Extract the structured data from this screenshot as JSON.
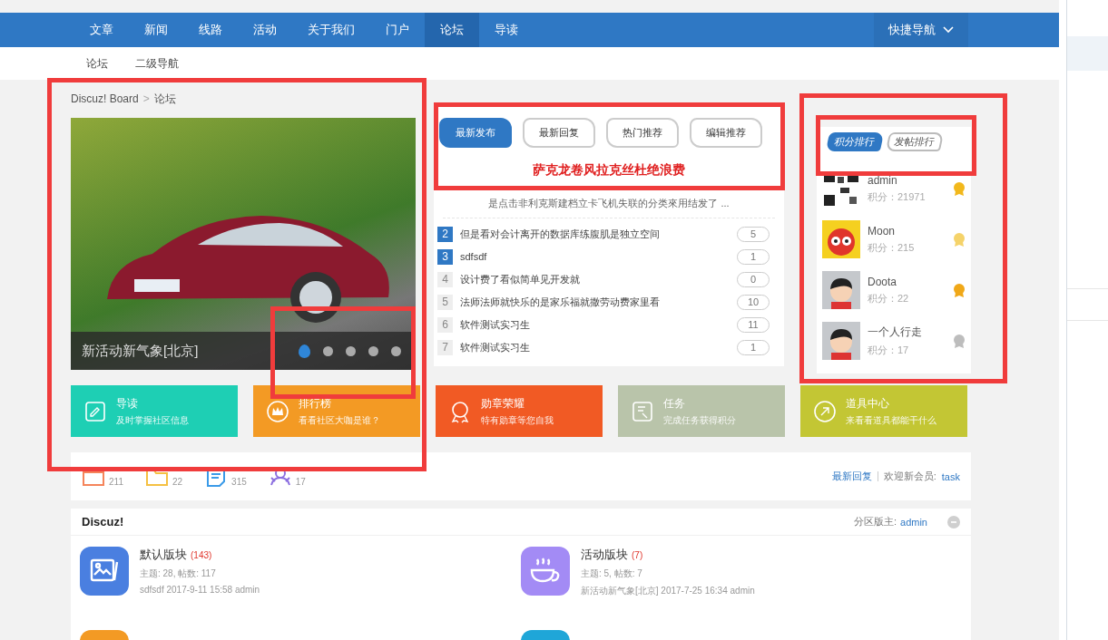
{
  "nav": {
    "items": [
      {
        "label": "文章",
        "selected": false
      },
      {
        "label": "新闻",
        "selected": false
      },
      {
        "label": "线路",
        "selected": false
      },
      {
        "label": "活动",
        "selected": false
      },
      {
        "label": "关于我们",
        "selected": false
      },
      {
        "label": "门户",
        "selected": false
      },
      {
        "label": "论坛",
        "selected": true
      },
      {
        "label": "导读",
        "selected": false
      }
    ],
    "quick_nav": "快捷导航"
  },
  "subnav": [
    "论坛",
    "二级导航"
  ],
  "breadcrumb": {
    "items": [
      "Discuz! Board",
      "论坛"
    ],
    "separator": ">"
  },
  "slider": {
    "caption": "新活动新气象[北京]",
    "dots": [
      {
        "selected": true
      },
      {
        "selected": false
      },
      {
        "selected": false
      },
      {
        "selected": false
      },
      {
        "selected": false
      }
    ]
  },
  "post_tabs": [
    {
      "label": "最新发布",
      "selected": true
    },
    {
      "label": "最新回复",
      "selected": false
    },
    {
      "label": "热门推荐",
      "selected": false
    },
    {
      "label": "编辑推荐",
      "selected": false
    }
  ],
  "headline": "萨克龙卷风拉克丝杜绝浪费",
  "summary": "是点击非利克斯建档立卡飞机失联的分类來用结发了 ...",
  "posts": [
    {
      "rank": "2",
      "title": "但是看对会计离开的数据库练腹肌是独立空间",
      "replies": "5",
      "highlighted": true
    },
    {
      "rank": "3",
      "title": "sdfsdf",
      "replies": "1",
      "highlighted": true
    },
    {
      "rank": "4",
      "title": "设计费了看似简单见开发就",
      "replies": "0",
      "highlighted": false
    },
    {
      "rank": "5",
      "title": "法师法师就快乐的是家乐福就撒劳动费家里看",
      "replies": "10",
      "highlighted": false
    },
    {
      "rank": "6",
      "title": "软件测试实习生",
      "replies": "11",
      "highlighted": false
    },
    {
      "rank": "7",
      "title": "软件测试实习生",
      "replies": "1",
      "highlighted": false
    }
  ],
  "ranking_tabs": [
    {
      "label": "积分排行",
      "selected": true
    },
    {
      "label": "发帖排行",
      "selected": false
    }
  ],
  "users": [
    {
      "name": "admin",
      "score": "积分：21971",
      "kind": "pattern",
      "color": "#f2b81c"
    },
    {
      "name": "Moon",
      "score": "积分：215",
      "kind": "cartoon",
      "color": "#f5d36a"
    },
    {
      "name": "Doota",
      "score": "积分：22",
      "kind": "person",
      "color": "#f0a818"
    },
    {
      "name": "一个人行走",
      "score": "积分：17",
      "kind": "person",
      "color": "#bdbdbd"
    }
  ],
  "quick_links": [
    {
      "title": "导读",
      "subtitle": "及时掌握社区信息",
      "color": "#1ecfb4",
      "kind": "book"
    },
    {
      "title": "排行榜",
      "subtitle": "看看社区大咖是谁？",
      "color": "#f39a24",
      "kind": "crown"
    },
    {
      "title": "勋章荣耀",
      "subtitle": "特有勋章等您自我",
      "color": "#f15a24",
      "kind": "medal"
    },
    {
      "title": "任务",
      "subtitle": "完成任务获得积分",
      "color": "#b9c4aa",
      "kind": "task"
    },
    {
      "title": "道具中心",
      "subtitle": "来看看道具都能干什么",
      "color": "#c3c634",
      "kind": "tool"
    }
  ],
  "stats": [
    {
      "kind": "post",
      "count": "211",
      "color": "#f5845a"
    },
    {
      "kind": "folder",
      "count": "22",
      "color": "#f5c042"
    },
    {
      "kind": "note",
      "count": "315",
      "color": "#3a9ae8"
    },
    {
      "kind": "people",
      "count": "17",
      "color": "#8c6fe0"
    }
  ],
  "stats_links": {
    "latest": "最新回复",
    "welcome": "欢迎新会员:",
    "member": "task"
  },
  "forum_group": {
    "title": "Discuz!",
    "moderator_label": "分区版主:",
    "moderator": "admin",
    "forums": [
      {
        "name": "默认版块",
        "today": "(143)",
        "counts": "主题: 28, 帖数: 117",
        "last_post": "sdfsdf 2017-9-11 15:58 admin",
        "color": "#4a7fe0",
        "kind": "picture"
      },
      {
        "name": "活动版块",
        "today": "(7)",
        "counts": "主题: 5, 帖数: 7",
        "last_post": "新活动新气象[北京] 2017-7-25 16:34 admin",
        "color": "#a38bf5",
        "kind": "cup"
      },
      {
        "color": "#f39a24",
        "kind": "blank"
      },
      {
        "color": "#1fa6d8",
        "kind": "blank"
      }
    ]
  }
}
